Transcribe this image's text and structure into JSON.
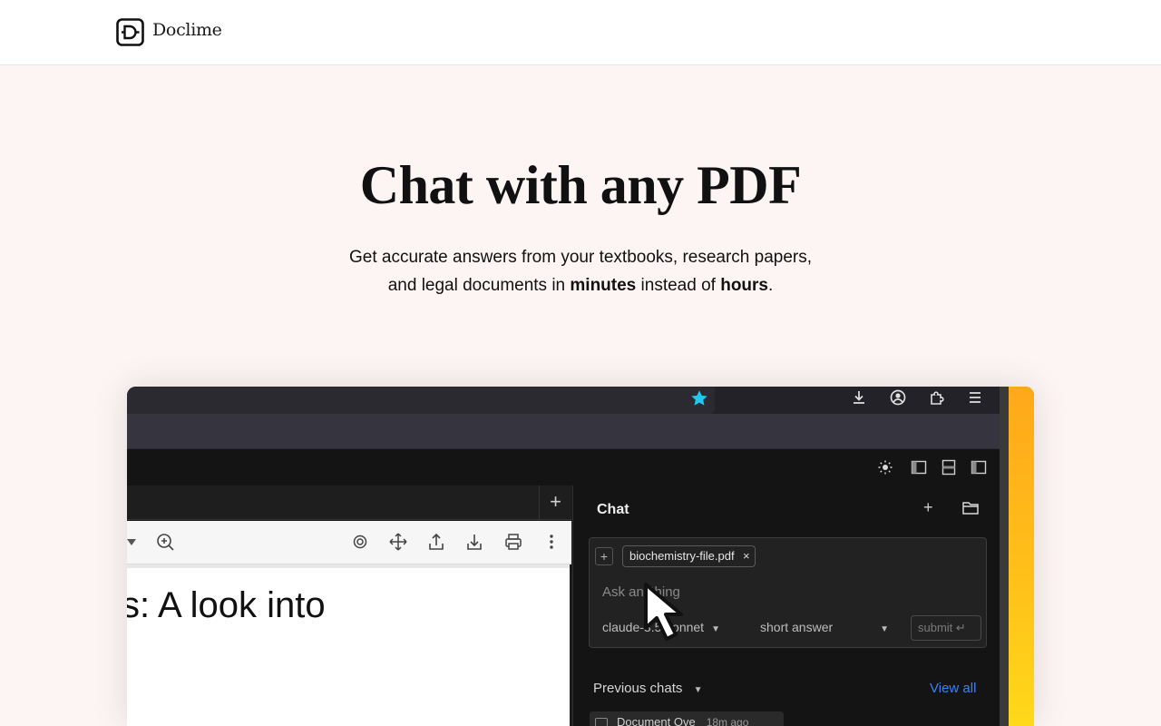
{
  "nav": {
    "brand": "Doclime"
  },
  "hero": {
    "title": "Chat with any PDF",
    "subtitle_line1": "Get accurate answers from your textbooks, research papers,",
    "subtitle_line2_pre": "and legal documents in ",
    "subtitle_bold1": "minutes",
    "subtitle_mid": " instead of ",
    "subtitle_bold2": "hours",
    "subtitle_end": "."
  },
  "screenshot": {
    "browser_icons": [
      "star-icon",
      "download-icon",
      "account-icon",
      "extensions-icon",
      "menu-icon"
    ],
    "toolbar_icons": [
      "theme-sun-icon",
      "left-panel-icon",
      "split-panel-icon",
      "right-panel-icon"
    ],
    "new_tab_label": "+",
    "pdf_toolbar_icons": [
      "dropdown-arrow-icon",
      "zoom-in-icon",
      "ai-icon",
      "move-icon",
      "upload-icon",
      "download-icon",
      "print-icon",
      "more-icon"
    ],
    "pdf_heading": "s: A look into",
    "chat": {
      "title": "Chat",
      "new_label": "+",
      "attached_file": "biochemistry-file.pdf",
      "input_placeholder": "Ask anything",
      "model": "claude-3.5-sonnet",
      "answer_mode": "short answer",
      "submit_label": "submit ↵",
      "previous_chats_label": "Previous chats",
      "view_all_label": "View all",
      "chat_items": [
        {
          "title": "Document Ove",
          "time": "18m ago"
        }
      ]
    }
  },
  "colors": {
    "page_bg": "#fdf5f3",
    "accent_yellow": "#ffc21a",
    "link_blue": "#3b82f6",
    "star_cyan": "#1ec8f0"
  }
}
